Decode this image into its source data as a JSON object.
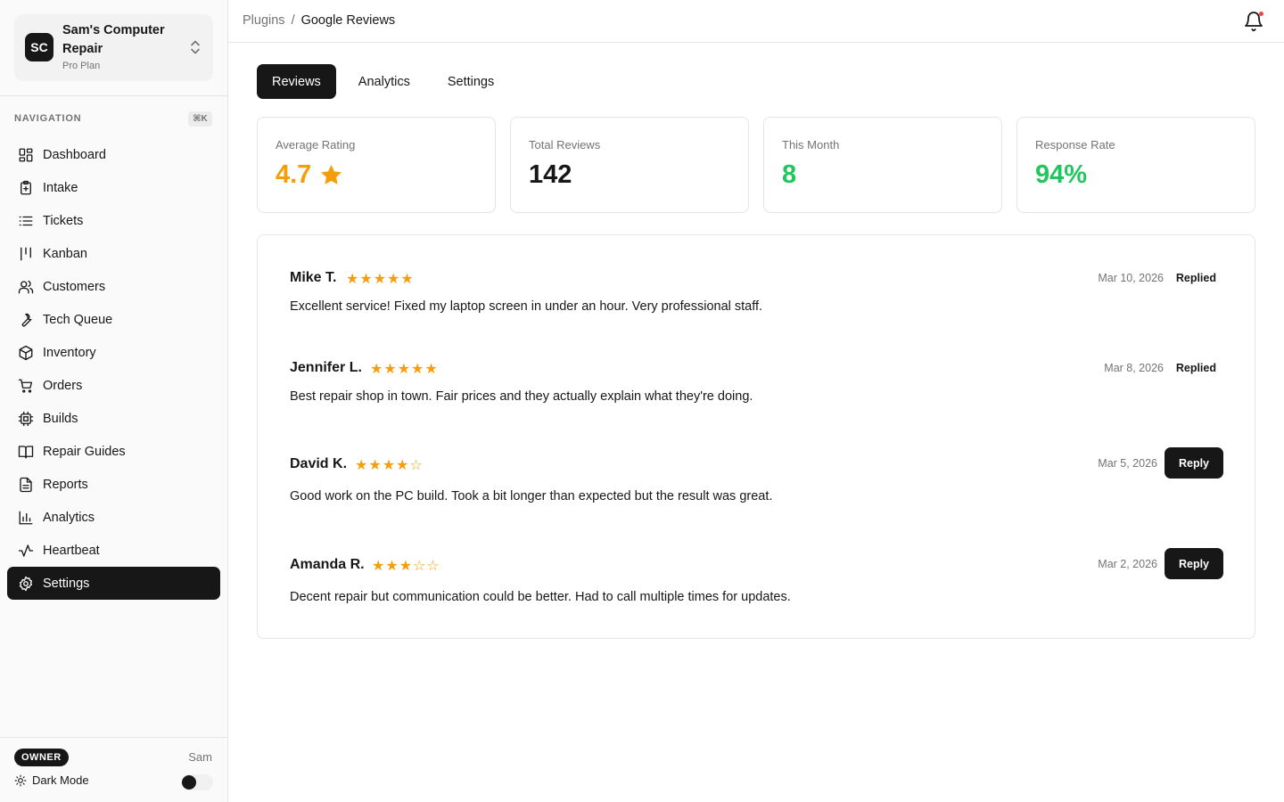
{
  "org": {
    "initials": "SC",
    "name": "Sam's Computer Repair",
    "plan": "Pro Plan"
  },
  "nav": {
    "heading": "NAVIGATION",
    "shortcut": "⌘K",
    "items": [
      {
        "label": "Dashboard",
        "icon": "dashboard-icon"
      },
      {
        "label": "Intake",
        "icon": "clipboard-icon"
      },
      {
        "label": "Tickets",
        "icon": "list-icon"
      },
      {
        "label": "Kanban",
        "icon": "kanban-icon"
      },
      {
        "label": "Customers",
        "icon": "users-icon"
      },
      {
        "label": "Tech Queue",
        "icon": "wrench-icon"
      },
      {
        "label": "Inventory",
        "icon": "package-icon"
      },
      {
        "label": "Orders",
        "icon": "cart-icon"
      },
      {
        "label": "Builds",
        "icon": "cpu-icon"
      },
      {
        "label": "Repair Guides",
        "icon": "book-icon"
      },
      {
        "label": "Reports",
        "icon": "file-text-icon"
      },
      {
        "label": "Analytics",
        "icon": "bar-chart-icon"
      },
      {
        "label": "Heartbeat",
        "icon": "activity-icon"
      },
      {
        "label": "Settings",
        "icon": "gear-icon",
        "active": true
      }
    ]
  },
  "footer": {
    "role": "OWNER",
    "user": "Sam",
    "dark_mode_label": "Dark Mode",
    "dark_mode_on": false
  },
  "breadcrumb": {
    "parent": "Plugins",
    "separator": "/",
    "current": "Google Reviews"
  },
  "tabs": [
    {
      "label": "Reviews",
      "active": true
    },
    {
      "label": "Analytics",
      "active": false
    },
    {
      "label": "Settings",
      "active": false
    }
  ],
  "stats": [
    {
      "label": "Average Rating",
      "value": "4.7",
      "color": "#f59e0b",
      "star": true
    },
    {
      "label": "Total Reviews",
      "value": "142",
      "color": "#171717"
    },
    {
      "label": "This Month",
      "value": "8",
      "color": "#22c55e"
    },
    {
      "label": "Response Rate",
      "value": "94%",
      "color": "#22c55e"
    }
  ],
  "reviews": [
    {
      "author": "Mike T.",
      "rating": 5,
      "date": "Mar 10, 2026",
      "status": "Replied",
      "text": "Excellent service! Fixed my laptop screen in under an hour. Very professional staff."
    },
    {
      "author": "Jennifer L.",
      "rating": 5,
      "date": "Mar 8, 2026",
      "status": "Replied",
      "text": "Best repair shop in town. Fair prices and they actually explain what they're doing."
    },
    {
      "author": "David K.",
      "rating": 4,
      "date": "Mar 5, 2026",
      "status": "Reply",
      "text": "Good work on the PC build. Took a bit longer than expected but the result was great."
    },
    {
      "author": "Amanda R.",
      "rating": 3,
      "date": "Mar 2, 2026",
      "status": "Reply",
      "text": "Decent repair but communication could be better. Had to call multiple times for updates."
    }
  ],
  "colors": {
    "accent": "#171717",
    "star": "#f59e0b",
    "positive": "#22c55e",
    "notification": "#ef4444"
  }
}
